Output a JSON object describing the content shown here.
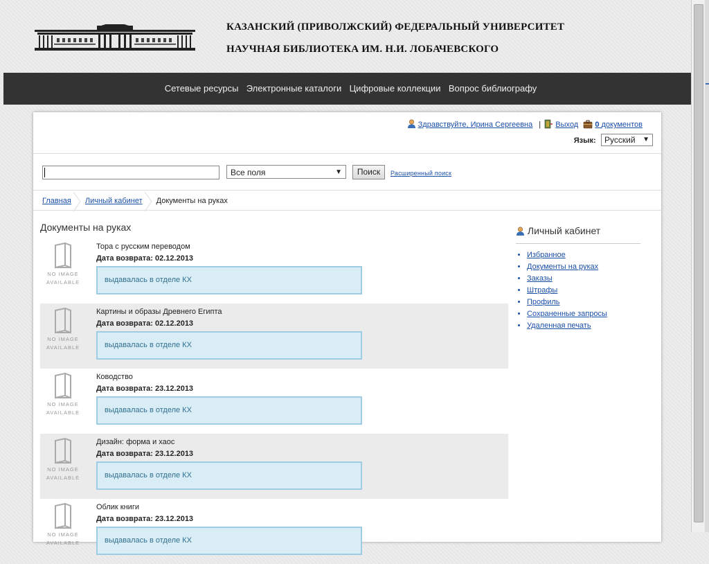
{
  "header": {
    "university": "КАЗАНСКИЙ (ПРИВОЛЖСКИЙ) ФЕДЕРАЛЬНЫЙ УНИВЕРСИТЕТ",
    "library": "НАУЧНАЯ БИБЛИОТЕКА ИМ. Н.И. ЛОБАЧЕВСКОГО"
  },
  "nav": {
    "items": [
      "Сетевые ресурсы",
      "Электронные каталоги",
      "Цифровые коллекции",
      "Вопрос библиографу"
    ]
  },
  "user": {
    "greeting": "Здравствуйте, Ирина Сергеевна",
    "separator": "|",
    "logout": "Выход",
    "cart_count": "0",
    "cart_label": "документов"
  },
  "language": {
    "label": "Язык:",
    "selected": "Русский"
  },
  "search": {
    "value": "",
    "field_selected": "Все поля",
    "button": "Поиск",
    "advanced": "Расширенный поиск"
  },
  "breadcrumb": [
    "Главная",
    "Личный кабинет",
    "Документы на руках"
  ],
  "page_title": "Документы на руках",
  "noimage": {
    "line1": "NO IMAGE",
    "line2": "AVAILABLE"
  },
  "documents": [
    {
      "title": "Тора с русским переводом",
      "due": "Дата возврата: 02.12.2013",
      "status": "выдавалась в отделе КХ"
    },
    {
      "title": "Картины и образы Древнего Египта",
      "due": "Дата возврата: 02.12.2013",
      "status": "выдавалась в отделе КХ"
    },
    {
      "title": "Ководство",
      "due": "Дата возврата: 23.12.2013",
      "status": "выдавалась в отделе КХ"
    },
    {
      "title": "Дизайн: форма и хаос",
      "due": "Дата возврата: 23.12.2013",
      "status": "выдавалась в отделе КХ"
    },
    {
      "title": "Облик книги",
      "due": "Дата возврата: 23.12.2013",
      "status": "выдавалась в отделе КХ"
    }
  ],
  "sidebar": {
    "title": "Личный кабинет",
    "items": [
      "Избранное",
      "Документы на руках",
      "Заказы",
      "Штрафы",
      "Профиль",
      "Сохраненные запросы",
      "Удаленная печать"
    ]
  }
}
